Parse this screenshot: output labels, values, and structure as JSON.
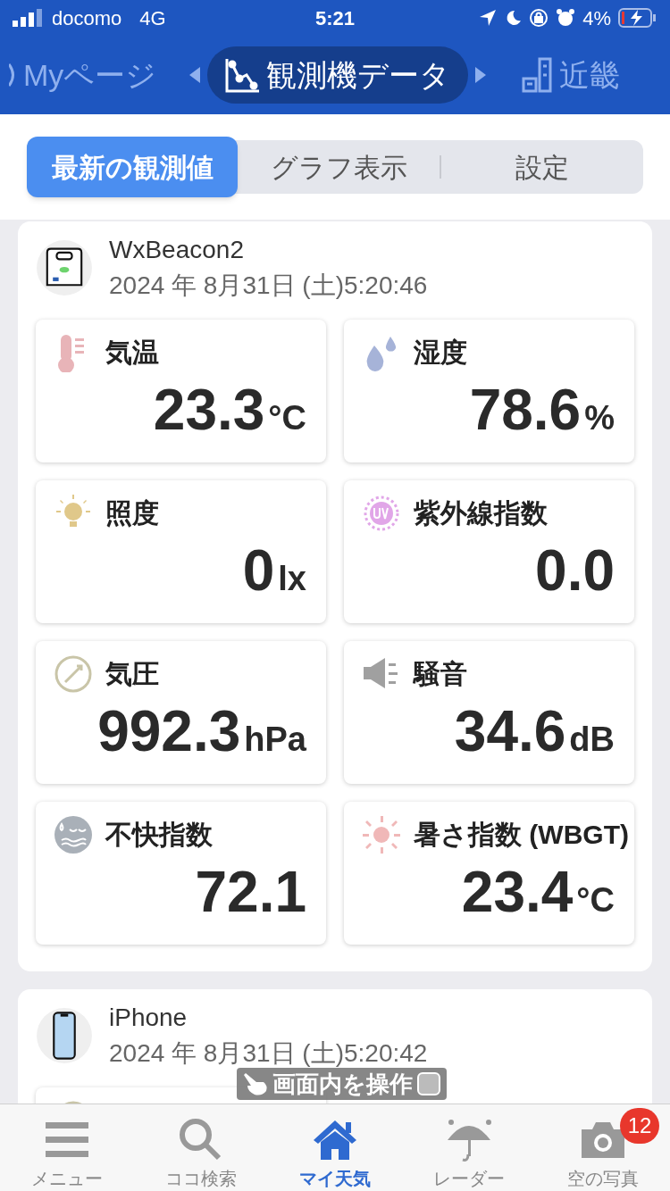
{
  "status_bar": {
    "carrier": "docomo",
    "network": "4G",
    "time": "5:21",
    "battery": "4%"
  },
  "header_tabs": [
    {
      "label": "Myページ",
      "selected": false
    },
    {
      "label": "観測機データ",
      "selected": true
    },
    {
      "label": "近畿",
      "selected": false
    }
  ],
  "segments": [
    {
      "label": "最新の観測値",
      "selected": true
    },
    {
      "label": "グラフ表示",
      "selected": false
    },
    {
      "label": "設定",
      "selected": false
    }
  ],
  "devices": [
    {
      "kind": "beacon",
      "name": "WxBeacon2",
      "timestamp": "2024 年 8月31日 (土)5:20:46",
      "metrics": [
        {
          "kind": "temperature",
          "label": "気温",
          "value": "23.3",
          "unit": "°C"
        },
        {
          "kind": "humidity",
          "label": "湿度",
          "value": "78.6",
          "unit": "%"
        },
        {
          "kind": "light",
          "label": "照度",
          "value": "0",
          "unit": "lx"
        },
        {
          "kind": "uv",
          "label": "紫外線指数",
          "value": "0.0"
        },
        {
          "kind": "pressure",
          "label": "気圧",
          "value": "992.3",
          "unit": "hPa"
        },
        {
          "kind": "noise",
          "label": "騒音",
          "value": "34.6",
          "unit": "dB"
        },
        {
          "kind": "discomfort",
          "label": "不快指数",
          "value": "72.1"
        },
        {
          "kind": "heat",
          "label": "暑さ指数 (WBGT)",
          "value": "23.4",
          "unit": "°C"
        }
      ]
    },
    {
      "kind": "phone",
      "name": "iPhone",
      "timestamp": "2024 年 8月31日 (土)5:20:42",
      "metrics": [
        {
          "kind": "pressure"
        }
      ]
    }
  ],
  "overlay": {
    "label": "画面内を操作"
  },
  "bottom_nav": [
    {
      "kind": "menu",
      "label": "メニュー",
      "selected": false
    },
    {
      "kind": "search",
      "label": "ココ検索",
      "selected": false
    },
    {
      "kind": "home",
      "label": "マイ天気",
      "selected": true
    },
    {
      "kind": "radar",
      "label": "レーダー",
      "selected": false
    },
    {
      "kind": "camera",
      "label": "空の写真",
      "selected": false,
      "badge": "12"
    }
  ]
}
